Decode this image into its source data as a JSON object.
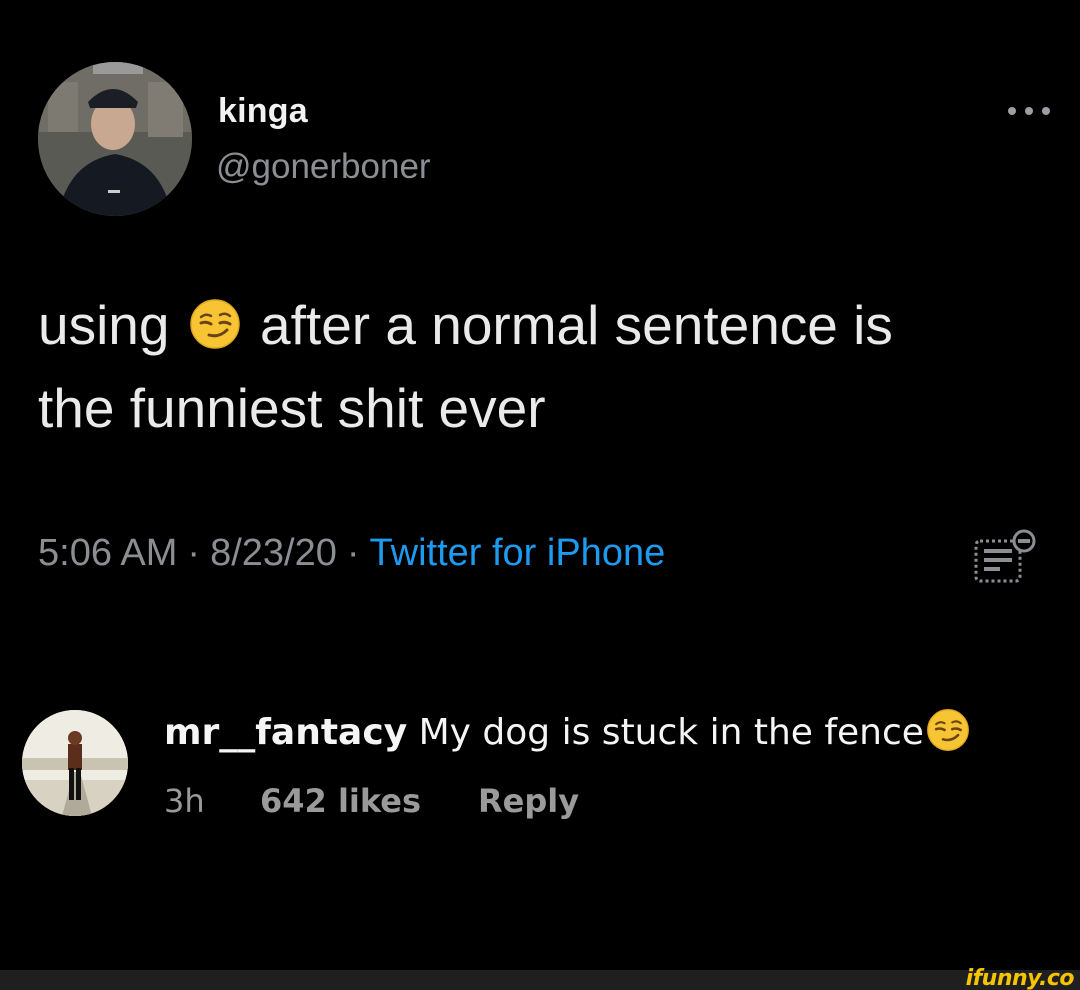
{
  "tweet": {
    "display_name": "kinga",
    "handle": "@gonerboner",
    "more_icon": "more-horizontal-icon",
    "text_before_emoji": "using",
    "emoji": "smirking-face",
    "text_after_emoji_line1": "after a normal sentence is",
    "text_line2": "the funniest shit ever",
    "time": "5:06 AM",
    "separator": "·",
    "date": "8/23/20",
    "source": "Twitter for iPhone",
    "analytics_icon": "analytics-icon",
    "source_color": "#1d9bf0"
  },
  "comment": {
    "username": "mr__fantacy",
    "text": "My dog is stuck in the fence",
    "emoji": "smirking-face",
    "time": "3h",
    "likes": "642 likes",
    "reply": "Reply"
  },
  "watermark": {
    "text": "ifunny.co",
    "color": "#f6c400"
  }
}
